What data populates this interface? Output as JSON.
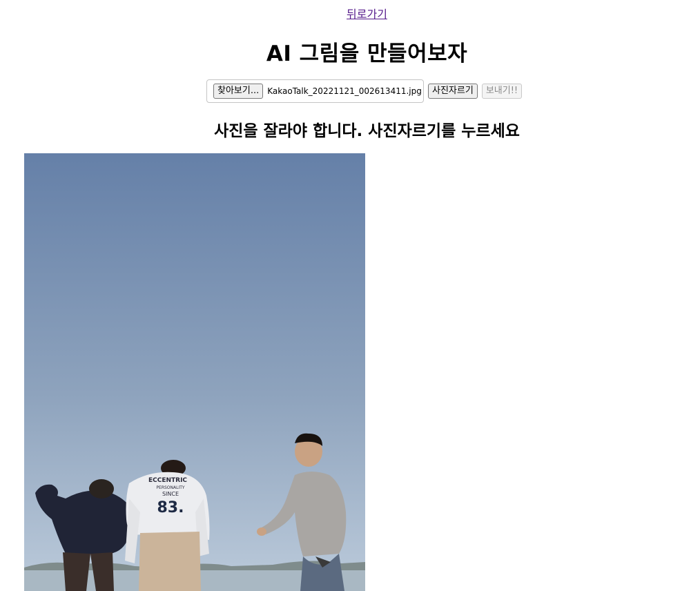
{
  "nav": {
    "back_label": "뒤로가기"
  },
  "header": {
    "title": "AI 그림을 만들어보자"
  },
  "upload": {
    "browse_label": "찾아보기...",
    "file_name": "KakaoTalk_20221121_002613411.jpg",
    "crop_label": "사진자르기",
    "send_label": "보내기!!"
  },
  "instruction": "사진을 잘라야 합니다. 사진자르기를 누르세요",
  "photo": {
    "shirt_text_top": "ECCENTRIC",
    "shirt_text_mid": "PERSONALITY",
    "shirt_text_since": "SINCE",
    "shirt_text_number": "83."
  },
  "colors": {
    "sky_top": "#6580a8",
    "sky_bottom": "#b7c7d8",
    "link": "#551a8b"
  }
}
